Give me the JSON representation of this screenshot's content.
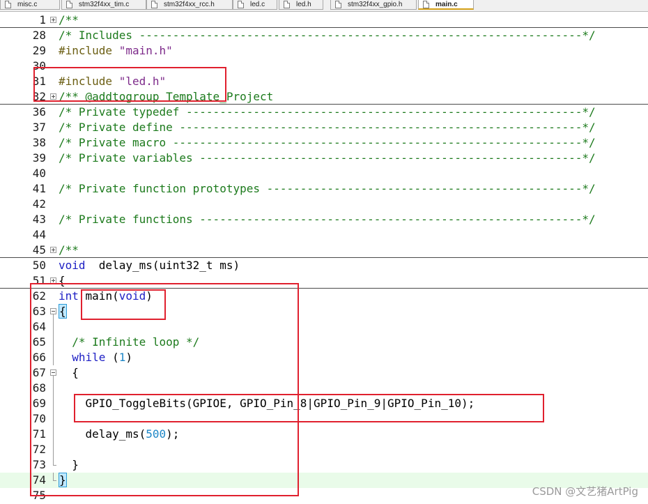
{
  "tabs": [
    {
      "label": "misc.c",
      "active": false
    },
    {
      "label": "stm32f4xx_tim.c",
      "active": false
    },
    {
      "label": "stm32f4xx_rcc.h",
      "active": false
    },
    {
      "label": "led.c",
      "active": false
    },
    {
      "label": "led.h",
      "active": false
    },
    {
      "label": "stm32f4xx_gpio.h",
      "active": false
    },
    {
      "label": "main.c",
      "active": true
    }
  ],
  "editor": {
    "current_line": "74",
    "lines": [
      {
        "num": "1",
        "fold": "plus",
        "segments": [
          [
            "c-com",
            "/**"
          ]
        ]
      },
      {
        "num": "28",
        "fold": "",
        "segments": [
          [
            "c-com",
            "/* Includes ------------------------------------------------------------------*/"
          ]
        ]
      },
      {
        "num": "29",
        "fold": "",
        "segments": [
          [
            "c-pp",
            "#include "
          ],
          [
            "c-str",
            "\"main.h\""
          ]
        ]
      },
      {
        "num": "30",
        "fold": "",
        "segments": []
      },
      {
        "num": "31",
        "fold": "",
        "segments": [
          [
            "c-pp",
            "#include "
          ],
          [
            "c-str",
            "\"led.h\""
          ]
        ]
      },
      {
        "num": "32",
        "fold": "plus",
        "segments": [
          [
            "c-com",
            "/** @addtogroup Template_Project"
          ]
        ]
      },
      {
        "num": "36",
        "fold": "",
        "segments": [
          [
            "c-com",
            "/* Private typedef -----------------------------------------------------------*/"
          ]
        ]
      },
      {
        "num": "37",
        "fold": "",
        "segments": [
          [
            "c-com",
            "/* Private define ------------------------------------------------------------*/"
          ]
        ]
      },
      {
        "num": "38",
        "fold": "",
        "segments": [
          [
            "c-com",
            "/* Private macro -------------------------------------------------------------*/"
          ]
        ]
      },
      {
        "num": "39",
        "fold": "",
        "segments": [
          [
            "c-com",
            "/* Private variables ---------------------------------------------------------*/"
          ]
        ]
      },
      {
        "num": "40",
        "fold": "",
        "segments": []
      },
      {
        "num": "41",
        "fold": "",
        "segments": [
          [
            "c-com",
            "/* Private function prototypes -----------------------------------------------*/"
          ]
        ]
      },
      {
        "num": "42",
        "fold": "",
        "segments": []
      },
      {
        "num": "43",
        "fold": "",
        "segments": [
          [
            "c-com",
            "/* Private functions ---------------------------------------------------------*/"
          ]
        ]
      },
      {
        "num": "44",
        "fold": "",
        "segments": []
      },
      {
        "num": "45",
        "fold": "plus",
        "segments": [
          [
            "c-com",
            "/**"
          ]
        ]
      },
      {
        "num": "50",
        "fold": "",
        "segments": [
          [
            "c-kw",
            "void"
          ],
          [
            "",
            "  delay_ms(uint32_t ms)"
          ]
        ]
      },
      {
        "num": "51",
        "fold": "plus",
        "segments": [
          [
            "",
            "{"
          ]
        ]
      },
      {
        "num": "62",
        "fold": "",
        "segments": [
          [
            "c-kw",
            "int"
          ],
          [
            "",
            " main("
          ],
          [
            "c-kw",
            "void"
          ],
          [
            "",
            ")"
          ]
        ]
      },
      {
        "num": "63",
        "fold": "minus",
        "segments": [
          [
            "c-brace",
            "{"
          ]
        ]
      },
      {
        "num": "64",
        "fold": "vline",
        "segments": []
      },
      {
        "num": "65",
        "fold": "vline",
        "segments": [
          [
            "",
            "  "
          ],
          [
            "c-com",
            "/* Infinite loop */"
          ]
        ]
      },
      {
        "num": "66",
        "fold": "vline",
        "segments": [
          [
            "",
            "  "
          ],
          [
            "c-kw",
            "while"
          ],
          [
            "",
            " ("
          ],
          [
            "c-num",
            "1"
          ],
          [
            "",
            ")"
          ]
        ]
      },
      {
        "num": "67",
        "fold": "minus",
        "segments": [
          [
            "",
            "  {"
          ]
        ]
      },
      {
        "num": "68",
        "fold": "vline",
        "segments": []
      },
      {
        "num": "69",
        "fold": "vline",
        "segments": [
          [
            "",
            "    GPIO_ToggleBits(GPIOE, GPIO_Pin_8|GPIO_Pin_9|GPIO_Pin_10);"
          ]
        ]
      },
      {
        "num": "70",
        "fold": "vline",
        "segments": []
      },
      {
        "num": "71",
        "fold": "vline",
        "segments": [
          [
            "",
            "    delay_ms("
          ],
          [
            "c-num",
            "500"
          ],
          [
            "",
            ");"
          ]
        ]
      },
      {
        "num": "72",
        "fold": "vline",
        "segments": []
      },
      {
        "num": "73",
        "fold": "tick",
        "segments": [
          [
            "",
            "  }"
          ]
        ]
      },
      {
        "num": "74",
        "fold": "tick",
        "segments": [
          [
            "c-brace",
            "}"
          ]
        ]
      },
      {
        "num": "75",
        "fold": "",
        "segments": []
      }
    ]
  },
  "watermark": "CSDN @文艺猪ArtPig",
  "colors": {
    "comment": "#1c7a1c",
    "keyword": "#1d1fc4",
    "string": "#7d2a8a",
    "preprocessor": "#6b5e12",
    "number": "#1e87c7",
    "annotation": "#e0202e",
    "current_line_bg": "#e9fbe9"
  },
  "icons": {
    "tab_file": "file-icon",
    "fold_collapsed": "fold-plus-icon",
    "fold_expanded": "fold-minus-icon"
  }
}
